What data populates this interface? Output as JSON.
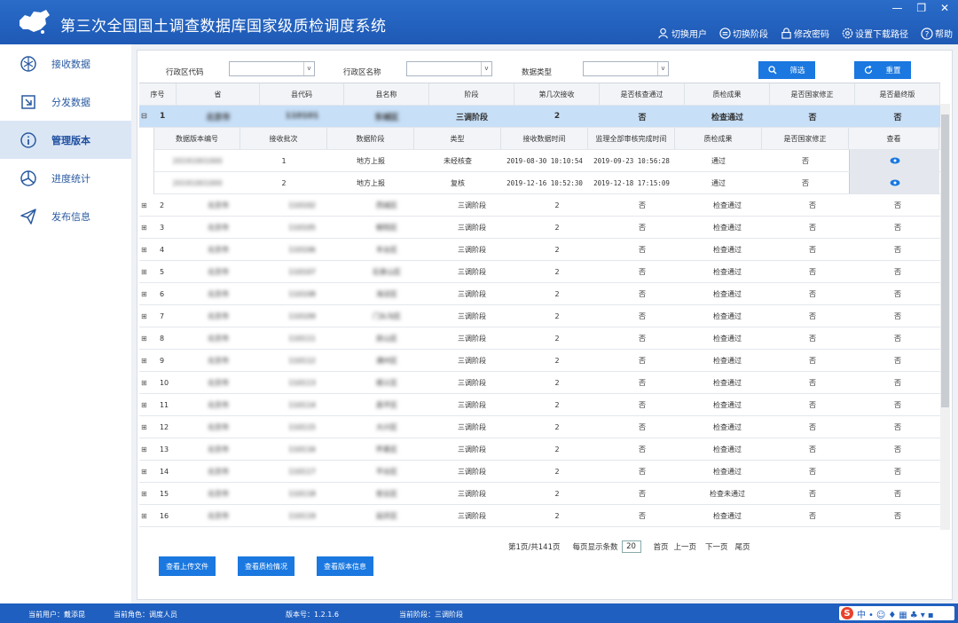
{
  "app": {
    "title": "第三次全国国土调查数据库国家级质检调度系统"
  },
  "window": {
    "minimize": "—",
    "restore": "❐",
    "close": "✕"
  },
  "header_actions": [
    {
      "label": "切换用户",
      "icon": "user-icon"
    },
    {
      "label": "切换阶段",
      "icon": "switch-icon"
    },
    {
      "label": "修改密码",
      "icon": "lock-icon"
    },
    {
      "label": "设置下载路径",
      "icon": "gear-icon"
    },
    {
      "label": "帮助",
      "icon": "help-icon"
    }
  ],
  "sidebar": {
    "items": [
      {
        "label": "接收数据",
        "icon": "receive-icon"
      },
      {
        "label": "分发数据",
        "icon": "distribute-icon"
      },
      {
        "label": "管理版本",
        "icon": "info-icon",
        "active": true
      },
      {
        "label": "进度统计",
        "icon": "pie-chart-icon"
      },
      {
        "label": "发布信息",
        "icon": "send-icon"
      }
    ]
  },
  "filters": {
    "region_code_label": "行政区代码",
    "region_name_label": "行政区名称",
    "data_type_label": "数据类型",
    "filter_button": "筛选",
    "reset_button": "重置"
  },
  "table": {
    "headers": [
      "序号",
      "省",
      "县代码",
      "县名称",
      "阶段",
      "第几次接收",
      "是否核查通过",
      "质检成果",
      "是否国家修正",
      "是否最终版"
    ],
    "selected": {
      "idx": "1",
      "prov": "北京市",
      "code": "110101",
      "county": "东城区",
      "stage": "三调阶段",
      "times": "2",
      "checked": "否",
      "result": "检查通过",
      "corrected": "否",
      "final": "否"
    },
    "sub": {
      "headers": [
        "数据版本编号",
        "接收批次",
        "数据阶段",
        "类型",
        "接收数据时间",
        "监理全部审核完成时间",
        "质检成果",
        "是否国家修正",
        "查看"
      ],
      "rows": [
        {
          "ver": "20191001000",
          "batch": "1",
          "stage": "地方上报",
          "type": "未经核查",
          "recv": "2019-08-30 10:10:54",
          "done": "2019-09-23 10:56:28",
          "result": "通过",
          "corrected": "否"
        },
        {
          "ver": "20191001000",
          "batch": "2",
          "stage": "地方上报",
          "type": "复核",
          "recv": "2019-12-16 10:52:30",
          "done": "2019-12-18 17:15:09",
          "result": "通过",
          "corrected": "否"
        }
      ]
    },
    "rows": [
      {
        "idx": "2",
        "prov": "北京市",
        "code": "110102",
        "county": "西城区",
        "stage": "三调阶段",
        "times": "2",
        "checked": "否",
        "result": "检查通过",
        "corrected": "否",
        "final": "否"
      },
      {
        "idx": "3",
        "prov": "北京市",
        "code": "110105",
        "county": "朝阳区",
        "stage": "三调阶段",
        "times": "2",
        "checked": "否",
        "result": "检查通过",
        "corrected": "否",
        "final": "否"
      },
      {
        "idx": "4",
        "prov": "北京市",
        "code": "110106",
        "county": "丰台区",
        "stage": "三调阶段",
        "times": "2",
        "checked": "否",
        "result": "检查通过",
        "corrected": "否",
        "final": "否"
      },
      {
        "idx": "5",
        "prov": "北京市",
        "code": "110107",
        "county": "石景山区",
        "stage": "三调阶段",
        "times": "2",
        "checked": "否",
        "result": "检查通过",
        "corrected": "否",
        "final": "否"
      },
      {
        "idx": "6",
        "prov": "北京市",
        "code": "110108",
        "county": "海淀区",
        "stage": "三调阶段",
        "times": "2",
        "checked": "否",
        "result": "检查通过",
        "corrected": "否",
        "final": "否"
      },
      {
        "idx": "7",
        "prov": "北京市",
        "code": "110109",
        "county": "门头沟区",
        "stage": "三调阶段",
        "times": "2",
        "checked": "否",
        "result": "检查通过",
        "corrected": "否",
        "final": "否"
      },
      {
        "idx": "8",
        "prov": "北京市",
        "code": "110111",
        "county": "房山区",
        "stage": "三调阶段",
        "times": "2",
        "checked": "否",
        "result": "检查通过",
        "corrected": "否",
        "final": "否"
      },
      {
        "idx": "9",
        "prov": "北京市",
        "code": "110112",
        "county": "通州区",
        "stage": "三调阶段",
        "times": "2",
        "checked": "否",
        "result": "检查通过",
        "corrected": "否",
        "final": "否"
      },
      {
        "idx": "10",
        "prov": "北京市",
        "code": "110113",
        "county": "顺义区",
        "stage": "三调阶段",
        "times": "2",
        "checked": "否",
        "result": "检查通过",
        "corrected": "否",
        "final": "否"
      },
      {
        "idx": "11",
        "prov": "北京市",
        "code": "110114",
        "county": "昌平区",
        "stage": "三调阶段",
        "times": "2",
        "checked": "否",
        "result": "检查通过",
        "corrected": "否",
        "final": "否"
      },
      {
        "idx": "12",
        "prov": "北京市",
        "code": "110115",
        "county": "大兴区",
        "stage": "三调阶段",
        "times": "2",
        "checked": "否",
        "result": "检查通过",
        "corrected": "否",
        "final": "否"
      },
      {
        "idx": "13",
        "prov": "北京市",
        "code": "110116",
        "county": "怀柔区",
        "stage": "三调阶段",
        "times": "2",
        "checked": "否",
        "result": "检查通过",
        "corrected": "否",
        "final": "否"
      },
      {
        "idx": "14",
        "prov": "北京市",
        "code": "110117",
        "county": "平谷区",
        "stage": "三调阶段",
        "times": "2",
        "checked": "否",
        "result": "检查通过",
        "corrected": "否",
        "final": "否"
      },
      {
        "idx": "15",
        "prov": "北京市",
        "code": "110118",
        "county": "密云区",
        "stage": "三调阶段",
        "times": "2",
        "checked": "否",
        "result": "检查未通过",
        "corrected": "否",
        "final": "否"
      },
      {
        "idx": "16",
        "prov": "北京市",
        "code": "110119",
        "county": "延庆区",
        "stage": "三调阶段",
        "times": "2",
        "checked": "否",
        "result": "检查通过",
        "corrected": "否",
        "final": "否"
      }
    ]
  },
  "pager": {
    "info": "第1页/共141页",
    "size_label": "每页显示条数",
    "size": "20",
    "first": "首页",
    "prev": "上一页",
    "next": "下一页",
    "last": "尾页"
  },
  "actions": {
    "upload": "查看上传文件",
    "qc": "查看质检情况",
    "version": "查看版本信息"
  },
  "status": {
    "user": "当前用户：戴添昆",
    "role": "当前角色：调度人员",
    "version": "版本号：1.2.1.6",
    "stage": "当前阶段：三调阶段"
  },
  "colors": {
    "header": "#1e59b5",
    "accent": "#1a78e0",
    "selected_row": "#c7dff7"
  }
}
